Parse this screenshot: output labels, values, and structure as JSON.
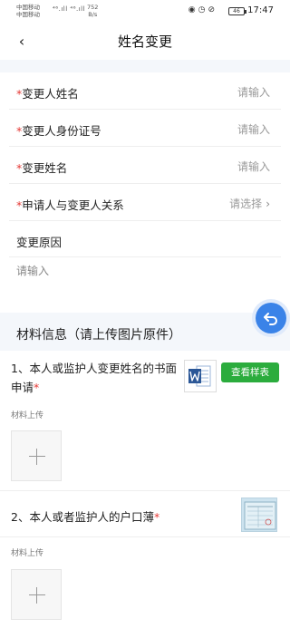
{
  "status_bar": {
    "carrier1": "中国移动",
    "carrier2": "中国移动",
    "signal": "⁴⁶.ıll ⁴⁶.ıll",
    "net_speed": "752",
    "net_unit": "B/s",
    "battery": "46",
    "time": "17:47"
  },
  "header": {
    "back_icon": "‹",
    "title": "姓名变更"
  },
  "form": {
    "rows": [
      {
        "label": "变更人姓名",
        "value": "请输入",
        "required": true
      },
      {
        "label": "变更人身份证号",
        "value": "请输入",
        "required": true
      },
      {
        "label": "变更姓名",
        "value": "请输入",
        "required": true
      },
      {
        "label": "申请人与变更人关系",
        "value": "请选择",
        "required": true,
        "chevron": "›"
      }
    ],
    "reason_label": "变更原因",
    "reason_placeholder": "请输入",
    "required_mark": "*"
  },
  "materials": {
    "section_title": "材料信息（请上传图片原件）",
    "item1": {
      "title": "1、本人或监护人变更姓名的书面申请",
      "sample_button": "查看样表",
      "upload_label": "材料上传",
      "thumb_icon": "word-document-icon"
    },
    "item2": {
      "title": "2、本人或者监护人的户口薄",
      "upload_label": "材料上传",
      "thumb_icon": "household-register-photo"
    }
  },
  "colors": {
    "accent_blue": "#3a83e8",
    "button_green": "#2bac3d",
    "required_red": "#e53935",
    "section_bg": "#f4f7fb"
  }
}
